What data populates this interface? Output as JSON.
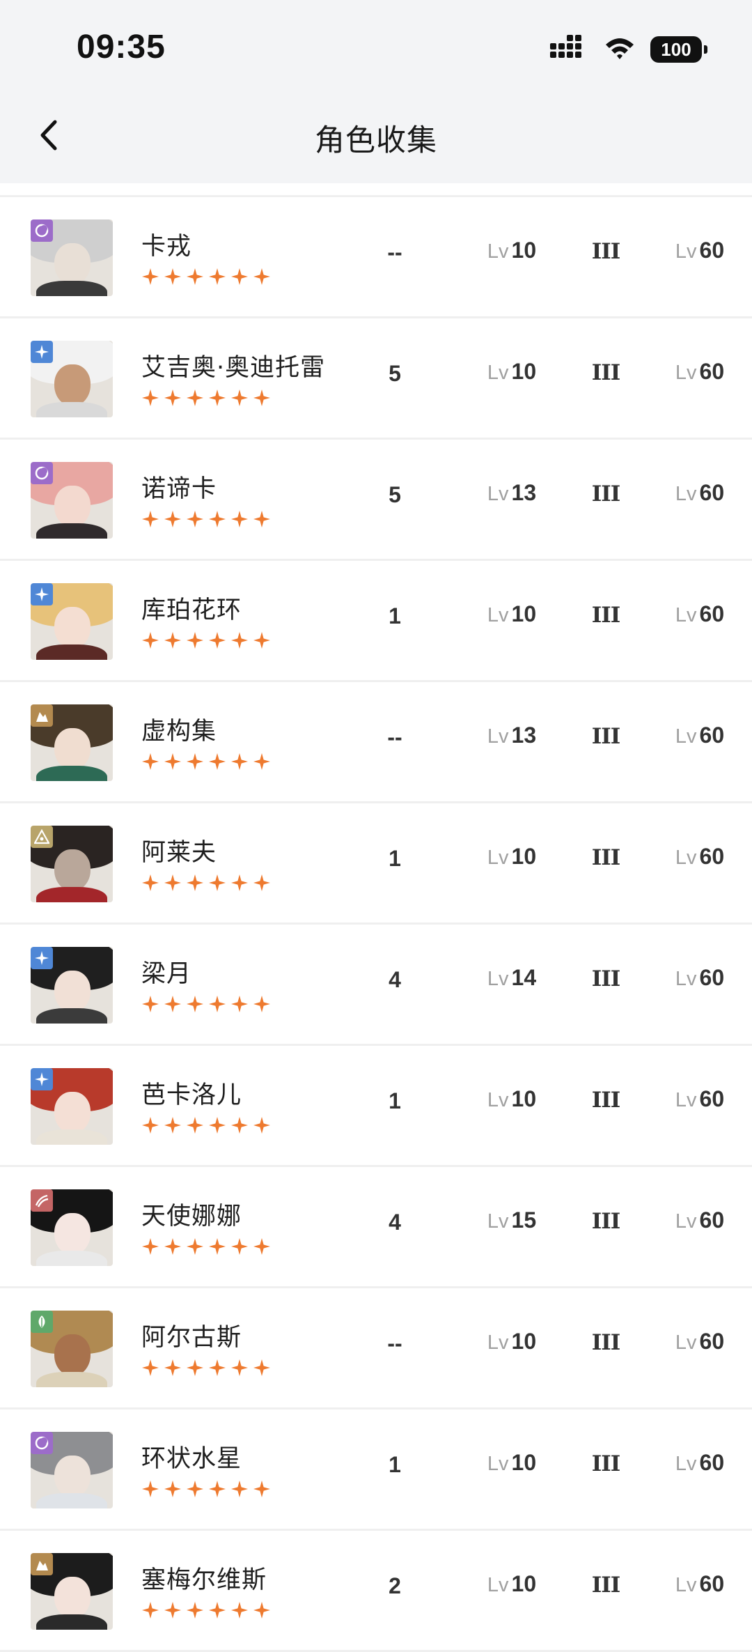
{
  "status_bar": {
    "time": "09:35",
    "battery": "100",
    "icons": [
      "signal-icon",
      "wifi-icon",
      "battery-icon"
    ]
  },
  "header": {
    "title": "角色收集",
    "back_icon": "chevron-left-icon"
  },
  "level_prefix": "Lv",
  "colors": {
    "star": "#ee7a2f",
    "divider": "#efefef",
    "header_bg": "#f3f4f6"
  },
  "characters": [
    {
      "name": "卡戎",
      "rarity": 6,
      "element": "moon",
      "element_color": "#9c6cc9",
      "potential": "--",
      "level": "10",
      "rank": "III",
      "max_level": "60"
    },
    {
      "name": "艾吉奥·奥迪托雷",
      "rarity": 6,
      "element": "star",
      "element_color": "#4f87d6",
      "potential": "5",
      "level": "10",
      "rank": "III",
      "max_level": "60"
    },
    {
      "name": "诺谛卡",
      "rarity": 6,
      "element": "moon",
      "element_color": "#9c6cc9",
      "potential": "5",
      "level": "13",
      "rank": "III",
      "max_level": "60"
    },
    {
      "name": "库珀花环",
      "rarity": 6,
      "element": "star",
      "element_color": "#4f87d6",
      "potential": "1",
      "level": "10",
      "rank": "III",
      "max_level": "60"
    },
    {
      "name": "虚构集",
      "rarity": 6,
      "element": "mineral",
      "element_color": "#b38a4f",
      "potential": "--",
      "level": "13",
      "rank": "III",
      "max_level": "60"
    },
    {
      "name": "阿莱夫",
      "rarity": 6,
      "element": "intellect",
      "element_color": "#b8a46a",
      "potential": "1",
      "level": "10",
      "rank": "III",
      "max_level": "60"
    },
    {
      "name": "梁月",
      "rarity": 6,
      "element": "star",
      "element_color": "#4f87d6",
      "potential": "4",
      "level": "14",
      "rank": "III",
      "max_level": "60"
    },
    {
      "name": "芭卡洛儿",
      "rarity": 6,
      "element": "star",
      "element_color": "#4f87d6",
      "potential": "1",
      "level": "10",
      "rank": "III",
      "max_level": "60"
    },
    {
      "name": "天使娜娜",
      "rarity": 6,
      "element": "beast",
      "element_color": "#c46565",
      "potential": "4",
      "level": "15",
      "rank": "III",
      "max_level": "60"
    },
    {
      "name": "阿尔古斯",
      "rarity": 6,
      "element": "plant",
      "element_color": "#5fa86a",
      "potential": "--",
      "level": "10",
      "rank": "III",
      "max_level": "60"
    },
    {
      "name": "环状水星",
      "rarity": 6,
      "element": "moon",
      "element_color": "#9c6cc9",
      "potential": "1",
      "level": "10",
      "rank": "III",
      "max_level": "60"
    },
    {
      "name": "塞梅尔维斯",
      "rarity": 6,
      "element": "mineral",
      "element_color": "#b38a4f",
      "potential": "2",
      "level": "10",
      "rank": "III",
      "max_level": "60"
    }
  ]
}
